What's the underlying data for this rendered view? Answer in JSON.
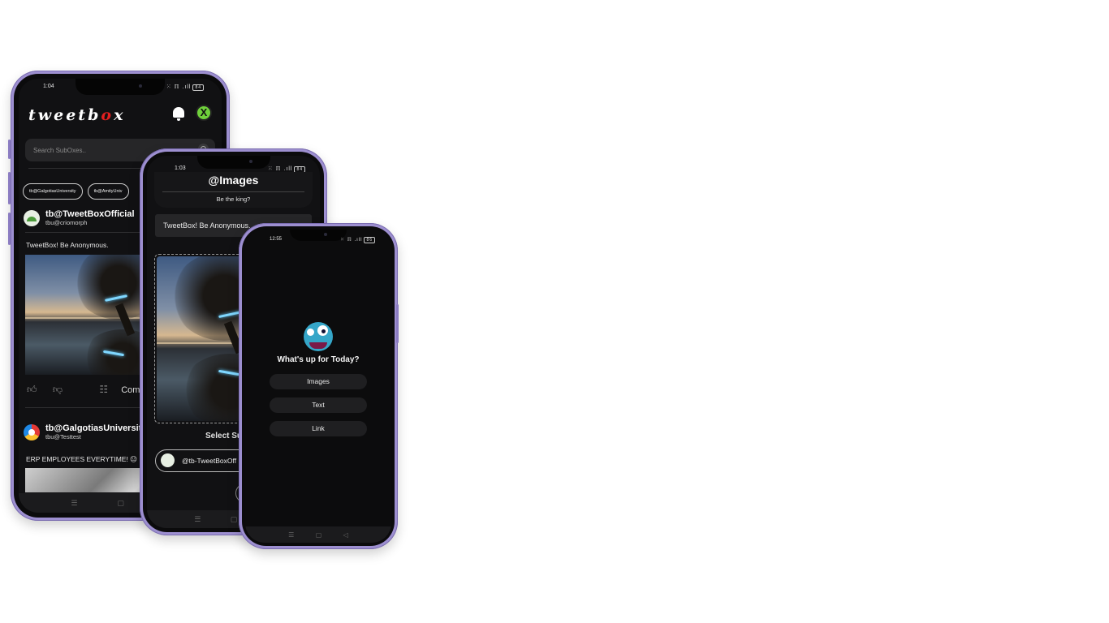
{
  "phone1": {
    "status_time": "1:04",
    "status_icons": "⁙ ℿ .ıll",
    "battery": "84",
    "logo_prefix": "tweetb",
    "logo_o": "o",
    "logo_suffix": "x",
    "search_placeholder": "Search SubOxes..",
    "chips": [
      "tb@GalgotiasUniversity",
      "tb@AmityUniv"
    ],
    "post1": {
      "name": "tb@TweetBoxOfficial",
      "handle": "tbu@criomorph",
      "text": "TweetBox!  Be Anonymous.",
      "comment_label": "Com"
    },
    "post2": {
      "name": "tb@GalgotiasUniversity",
      "handle": "tbu@Testtest",
      "text": "ERP EMPLOYEES EVERYTIME! 😐"
    },
    "nav": [
      "☰",
      "▢",
      "◁"
    ]
  },
  "phone2": {
    "status_time": "1:03",
    "status_icons": "⁙ ℿ .ıll",
    "battery": "84",
    "title": "@Images",
    "subtitle": "Be the king?",
    "text_field": "TweetBox!  Be Anonymous.",
    "select_label": "Select Su",
    "selected_subox": "@tb-TweetBoxOff",
    "nav": [
      "☰",
      "▢",
      "◁"
    ]
  },
  "phone3": {
    "status_time": "12:55",
    "status_icons": "⁙ ℿ .ıll",
    "battery": "86",
    "question": "What's up for Today?",
    "options": [
      "Images",
      "Text",
      "Link"
    ],
    "nav": [
      "☰",
      "▢",
      "◁"
    ]
  },
  "colors": {
    "frame": "#9d8fd0",
    "screen": "#111113",
    "logo_accent": "#e21f1f",
    "avatar_green": "#6fd13b",
    "mascot_blue": "#35a6c8"
  }
}
